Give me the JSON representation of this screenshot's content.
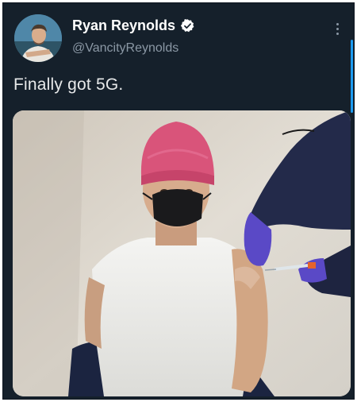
{
  "tweet": {
    "author": {
      "display_name": "Ryan Reynolds",
      "handle": "@VancityReynolds",
      "verified": true
    },
    "text": "Finally got 5G.",
    "media_alt_icon": "photo",
    "icons": {
      "verified": "verified-badge-icon",
      "more": "more-options-icon"
    }
  },
  "colors": {
    "background": "#15202b",
    "primary_text": "#e7e9ea",
    "secondary_text": "#8b98a5",
    "accent": "#1d9bf0"
  }
}
